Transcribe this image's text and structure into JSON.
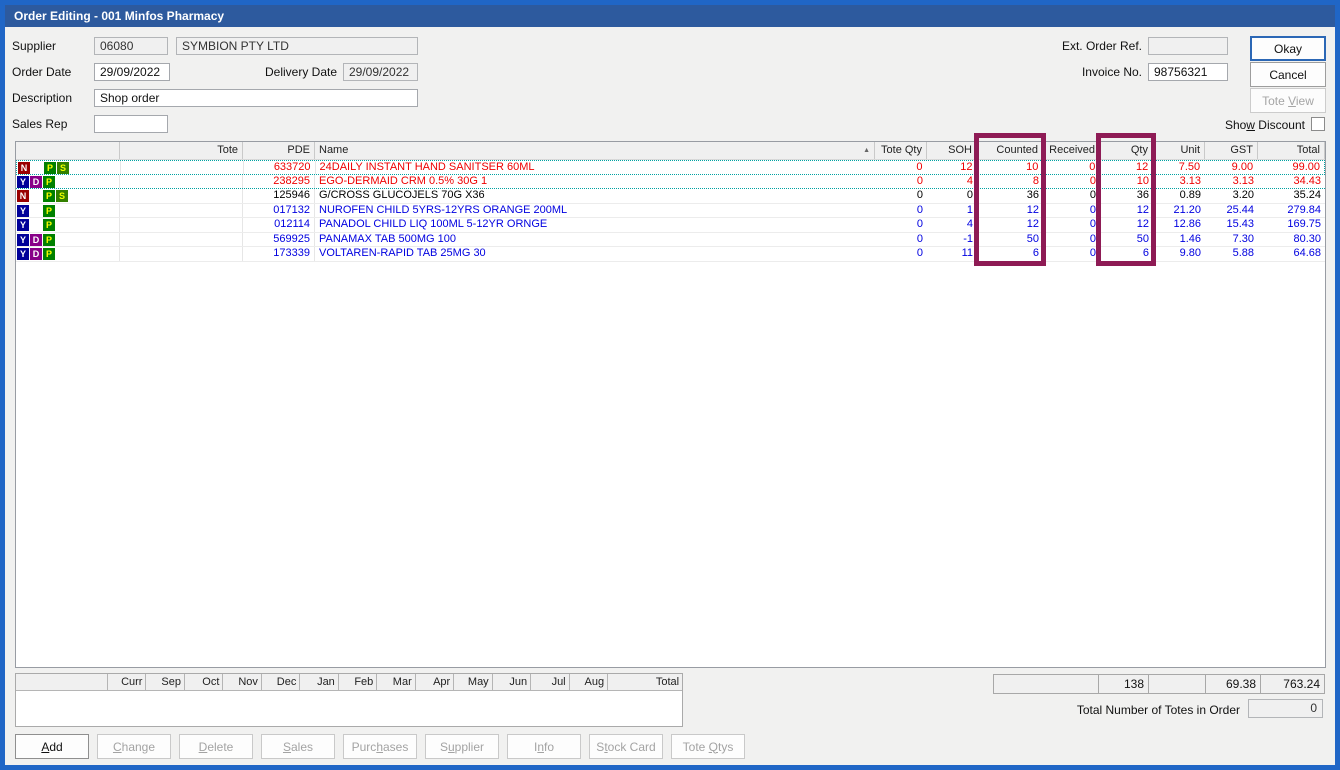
{
  "window": {
    "title": "Order Editing - 001 Minfos Pharmacy"
  },
  "form": {
    "supplier_label": "Supplier",
    "supplier_code": "06080",
    "supplier_name": "SYMBION PTY LTD",
    "order_date_label": "Order Date",
    "order_date": "29/09/2022",
    "delivery_date_label": "Delivery Date",
    "delivery_date": "29/09/2022",
    "description_label": "Description",
    "description": "Shop order",
    "sales_rep_label": "Sales Rep",
    "sales_rep": "",
    "ext_order_ref_label": "Ext. Order Ref.",
    "ext_order_ref": "",
    "invoice_no_label": "Invoice No.",
    "invoice_no": "98756321",
    "show_discount": {
      "label": "Show Discount",
      "underline": 3,
      "checked": false
    }
  },
  "actions": {
    "okay": {
      "label": "Okay",
      "underline": -1
    },
    "cancel": {
      "label": "Cancel",
      "underline": -1
    },
    "tote_view": {
      "label": "Tote View",
      "underline": 5
    }
  },
  "table": {
    "columns": [
      "",
      "Tote",
      "PDE",
      "Name",
      "Tote Qty",
      "SOH",
      "Counted",
      "Received",
      "Qty",
      "Unit",
      "GST",
      "Total"
    ],
    "sort_icon": "▲",
    "flag_colors": {
      "N": "#990000",
      "Y": "#000099",
      "D": "#880088",
      "P": "#008000",
      "S": "#338000"
    },
    "flag_text_colors": {
      "N": "#ffffff",
      "Y": "#ffffff",
      "D": "#ffffff",
      "P": "#ffff00",
      "S": "#eeff00"
    },
    "rows": [
      {
        "flags": [
          "N",
          null,
          "P",
          "S"
        ],
        "tote": "",
        "pde": "633720",
        "name": "24DAILY INSTANT HAND SANITSER 60ML",
        "tote_qty": "0",
        "soh": "12",
        "counted": "10",
        "received": "0",
        "qty": "12",
        "unit": "7.50",
        "gst": "9.00",
        "total": "99.00",
        "color": "#ee0000",
        "selected": true
      },
      {
        "flags": [
          "Y",
          "D",
          "P",
          null
        ],
        "tote": "",
        "pde": "238295",
        "name": "EGO-DERMAID CRM 0.5% 30G 1",
        "tote_qty": "0",
        "soh": "4",
        "counted": "8",
        "received": "0",
        "qty": "10",
        "unit": "3.13",
        "gst": "3.13",
        "total": "34.43",
        "color": "#ee0000",
        "selected_bottom": true
      },
      {
        "flags": [
          "N",
          null,
          "P",
          "S"
        ],
        "tote": "",
        "pde": "125946",
        "name": "G/CROSS GLUCOJELS 70G X36",
        "tote_qty": "0",
        "soh": "0",
        "counted": "36",
        "received": "0",
        "qty": "36",
        "unit": "0.89",
        "gst": "3.20",
        "total": "35.24",
        "color": "#000000"
      },
      {
        "flags": [
          "Y",
          null,
          "P",
          null
        ],
        "tote": "",
        "pde": "017132",
        "name": "NUROFEN CHILD 5YRS-12YRS ORANGE 200ML",
        "tote_qty": "0",
        "soh": "1",
        "counted": "12",
        "received": "0",
        "qty": "12",
        "unit": "21.20",
        "gst": "25.44",
        "total": "279.84",
        "color": "#0000e0"
      },
      {
        "flags": [
          "Y",
          null,
          "P",
          null
        ],
        "tote": "",
        "pde": "012114",
        "name": "PANADOL CHILD LIQ 100ML 5-12YR ORNGE",
        "tote_qty": "0",
        "soh": "4",
        "counted": "12",
        "received": "0",
        "qty": "12",
        "unit": "12.86",
        "gst": "15.43",
        "total": "169.75",
        "color": "#0000e0"
      },
      {
        "flags": [
          "Y",
          "D",
          "P",
          null
        ],
        "tote": "",
        "pde": "569925",
        "name": "PANAMAX TAB 500MG 100",
        "tote_qty": "0",
        "soh": "-1",
        "counted": "50",
        "received": "0",
        "qty": "50",
        "unit": "1.46",
        "gst": "7.30",
        "total": "80.30",
        "color": "#0000e0"
      },
      {
        "flags": [
          "Y",
          "D",
          "P",
          null
        ],
        "tote": "",
        "pde": "173339",
        "name": "VOLTAREN-RAPID TAB 25MG 30",
        "tote_qty": "0",
        "soh": "11",
        "counted": "6",
        "received": "0",
        "qty": "6",
        "unit": "9.80",
        "gst": "5.88",
        "total": "64.68",
        "color": "#0000e0"
      }
    ]
  },
  "highlights": {
    "color": "#8e1b55"
  },
  "months": {
    "labels": [
      "",
      "Curr",
      "Sep",
      "Oct",
      "Nov",
      "Dec",
      "Jan",
      "Feb",
      "Mar",
      "Apr",
      "May",
      "Jun",
      "Jul",
      "Aug",
      "Total"
    ]
  },
  "totals": {
    "cells": [
      "",
      "138",
      "",
      "69.38",
      "763.24"
    ],
    "totes_label": "Total Number of Totes in Order",
    "totes_value": "0"
  },
  "footer_buttons": [
    {
      "label": "Add",
      "underline": 0,
      "enabled": true
    },
    {
      "label": "Change",
      "underline": 0,
      "enabled": false
    },
    {
      "label": "Delete",
      "underline": 0,
      "enabled": false
    },
    {
      "label": "Sales",
      "underline": 0,
      "enabled": false
    },
    {
      "label": "Purchases",
      "underline": 4,
      "enabled": false
    },
    {
      "label": "Supplier",
      "underline": 1,
      "enabled": false
    },
    {
      "label": "Info",
      "underline": 1,
      "enabled": false
    },
    {
      "label": "Stock Card",
      "underline": 1,
      "enabled": false
    },
    {
      "label": "Tote Qtys",
      "underline": 5,
      "enabled": false
    }
  ]
}
